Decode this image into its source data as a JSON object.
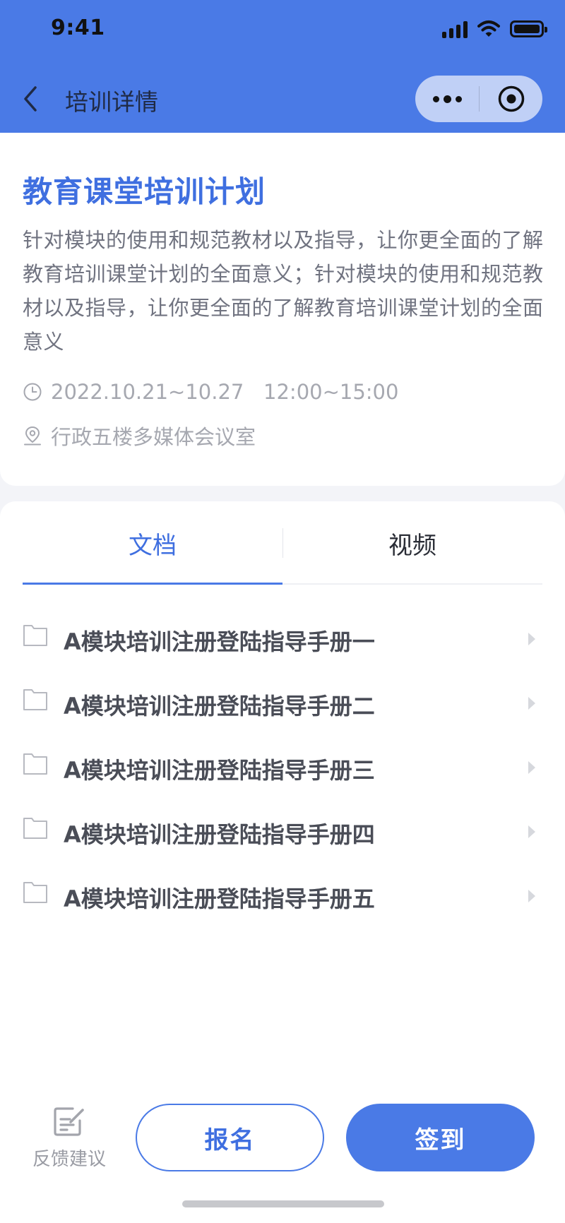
{
  "status_bar": {
    "time": "9:41"
  },
  "nav": {
    "title": "培训详情",
    "back_icon": "chevron-left-icon",
    "more_icon": "more-dots-icon",
    "close_icon": "target-circle-icon"
  },
  "course": {
    "title": "教育课堂培训计划",
    "description": "针对模块的使用和规范教材以及指导，让你更全面的了解教育培训课堂计划的全面意义；针对模块的使用和规范教材以及指导，让你更全面的了解教育培训课堂计划的全面意义",
    "date_time": "2022.10.21~10.27   12:00~15:00",
    "location": "行政五楼多媒体会议室"
  },
  "tabs": [
    {
      "label": "文档",
      "active": true
    },
    {
      "label": "视频",
      "active": false
    }
  ],
  "documents": [
    {
      "name": "A模块培训注册登陆指导手册一"
    },
    {
      "name": "A模块培训注册登陆指导手册二"
    },
    {
      "name": "A模块培训注册登陆指导手册三"
    },
    {
      "name": "A模块培训注册登陆指导手册四"
    },
    {
      "name": "A模块培训注册登陆指导手册五"
    }
  ],
  "bottom_bar": {
    "feedback_label": "反馈建议",
    "signup_label": "报名",
    "checkin_label": "签到"
  },
  "colors": {
    "brand": "#4A7AE6",
    "title": "#3F6FE0",
    "muted": "#A6A8B0"
  }
}
